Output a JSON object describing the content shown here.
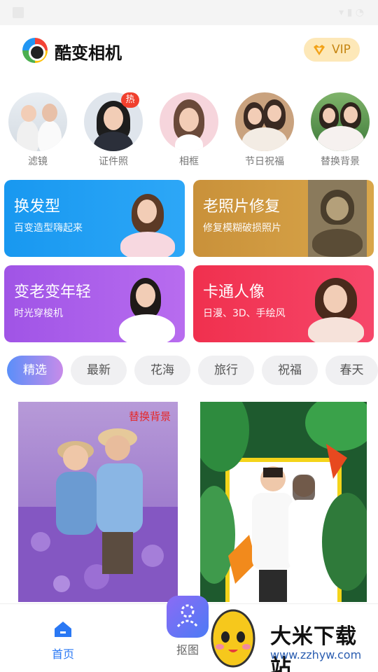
{
  "app": {
    "title": "酷变相机",
    "vip_label": "VIP"
  },
  "circles": [
    {
      "label": "滤镜",
      "badge": ""
    },
    {
      "label": "证件照",
      "badge": "热"
    },
    {
      "label": "相框",
      "badge": ""
    },
    {
      "label": "节日祝福",
      "badge": ""
    },
    {
      "label": "替换背景",
      "badge": ""
    }
  ],
  "cards": [
    {
      "title": "换发型",
      "subtitle": "百变造型嗨起来",
      "color": "#1a8df0"
    },
    {
      "title": "老照片修复",
      "subtitle": "修复模糊破损照片",
      "color": "#d9a23e"
    },
    {
      "title": "变老变年轻",
      "subtitle": "时光穿梭机",
      "color": "#a75ae8"
    },
    {
      "title": "卡通人像",
      "subtitle": "日漫、3D、手绘风",
      "color": "#f2385a"
    }
  ],
  "tabs": [
    "精选",
    "最新",
    "花海",
    "旅行",
    "祝福",
    "春天"
  ],
  "feed": {
    "left_tag": "替换背景"
  },
  "bottom_nav": {
    "home_label": "首页",
    "cutout_label": "抠图"
  },
  "watermark": {
    "text": "大米下载站",
    "url": "www.zzhyw.com"
  }
}
